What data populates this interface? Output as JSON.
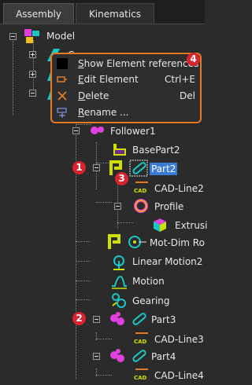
{
  "tabs": [
    {
      "label": "Assembly",
      "active": true
    },
    {
      "label": "Kinematics",
      "active": false
    }
  ],
  "tree": {
    "model": "Model",
    "cam_partial": "Cam",
    "follower": "Follower1",
    "basepart": "BasePart2",
    "part2": "Part2",
    "cadline2": "CAD-Line2",
    "profile": "Profile",
    "extrusion": "Extrusi",
    "motdim": "Mot-Dim Ro",
    "linearmotion": "Linear Motion2",
    "motion": "Motion",
    "gearing": "Gearing",
    "part3": "Part3",
    "cadline3": "CAD-Line3",
    "part4": "Part4",
    "cadline4": "CAD-Line4"
  },
  "badges": [
    "1",
    "2",
    "3",
    "4"
  ],
  "context_menu": {
    "items": [
      {
        "first": "S",
        "rest": "how Element references",
        "shortcut": "",
        "icon": "black-square-icon"
      },
      {
        "first": "E",
        "rest": "dit Element",
        "shortcut": "Ctrl+E",
        "icon": "edit-arrow-icon"
      },
      {
        "first": "D",
        "rest": "elete",
        "shortcut": "Del",
        "icon": "delete-x-icon"
      },
      {
        "first": "R",
        "rest": "ename ...",
        "shortcut": "",
        "icon": "rename-icon"
      }
    ]
  },
  "colors": {
    "accent": "#e07a23",
    "selection": "#3a7bd5",
    "badge": "#d9232f",
    "cyan": "#19c7c7",
    "yellow_green": "#cfe000",
    "magenta": "#e040e0",
    "background": "#2b2b2b"
  }
}
